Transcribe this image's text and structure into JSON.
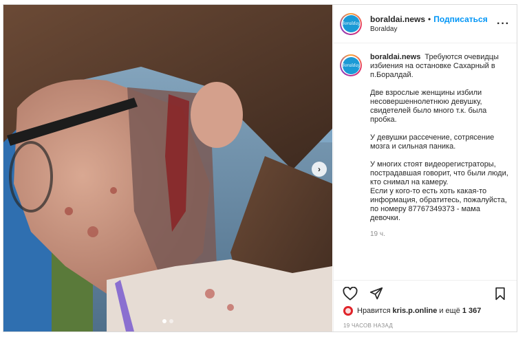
{
  "post": {
    "username": "boraldai.news",
    "follow_separator": "•",
    "follow_label": "Подписаться",
    "location": "Boralday",
    "avatar_text": "Boralday",
    "caption": [
      "Требуются очевидцы избиения на остановке Сахарный в п.Боралдай.",
      "Две взрослые женщины избили несовершеннолетнюю девушку, свидетелей было много т.к. была пробка.",
      "У девушки рассечение, сотрясение мозга и сильная паника.",
      "У многих стоят видеорегистраторы, пострадавшая говорит, что были люди, кто снимал на камеру.\nЕсли у кого-то есть хоть какая-то информация, обратитесь, пожалуйста, по номеру 87767349373 - мама девочки."
    ],
    "caption_time": "19 ч.",
    "likes_prefix": "Нравится",
    "likes_user": "kris.p.online",
    "likes_middle": "и ещё",
    "likes_count": "1 367",
    "timestamp": "19 ЧАСОВ НАЗАД",
    "more_icon": "more-dots-icon",
    "next_icon": "chevron-right-icon"
  },
  "colors": {
    "accent": "#0095f6",
    "muted": "#8e8e8e",
    "border": "#dbdbdb"
  }
}
